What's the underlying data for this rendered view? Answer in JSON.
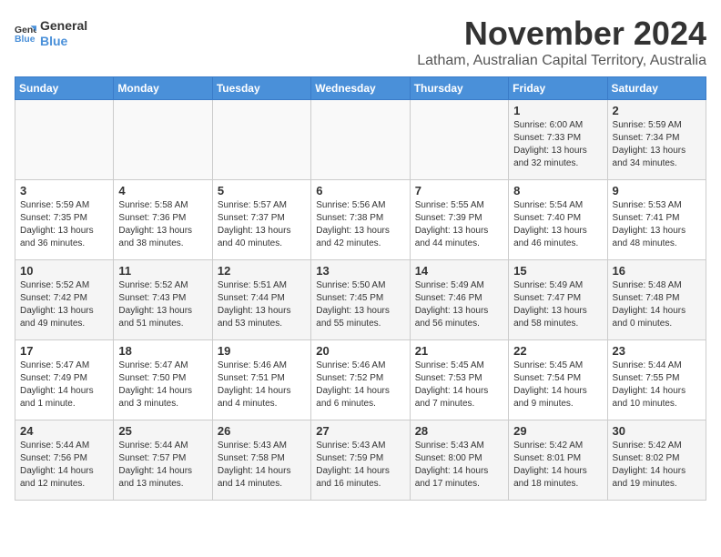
{
  "logo": {
    "line1": "General",
    "line2": "Blue"
  },
  "title": "November 2024",
  "location": "Latham, Australian Capital Territory, Australia",
  "days_of_week": [
    "Sunday",
    "Monday",
    "Tuesday",
    "Wednesday",
    "Thursday",
    "Friday",
    "Saturday"
  ],
  "weeks": [
    [
      {
        "day": "",
        "details": ""
      },
      {
        "day": "",
        "details": ""
      },
      {
        "day": "",
        "details": ""
      },
      {
        "day": "",
        "details": ""
      },
      {
        "day": "",
        "details": ""
      },
      {
        "day": "1",
        "details": "Sunrise: 6:00 AM\nSunset: 7:33 PM\nDaylight: 13 hours and 32 minutes."
      },
      {
        "day": "2",
        "details": "Sunrise: 5:59 AM\nSunset: 7:34 PM\nDaylight: 13 hours and 34 minutes."
      }
    ],
    [
      {
        "day": "3",
        "details": "Sunrise: 5:59 AM\nSunset: 7:35 PM\nDaylight: 13 hours and 36 minutes."
      },
      {
        "day": "4",
        "details": "Sunrise: 5:58 AM\nSunset: 7:36 PM\nDaylight: 13 hours and 38 minutes."
      },
      {
        "day": "5",
        "details": "Sunrise: 5:57 AM\nSunset: 7:37 PM\nDaylight: 13 hours and 40 minutes."
      },
      {
        "day": "6",
        "details": "Sunrise: 5:56 AM\nSunset: 7:38 PM\nDaylight: 13 hours and 42 minutes."
      },
      {
        "day": "7",
        "details": "Sunrise: 5:55 AM\nSunset: 7:39 PM\nDaylight: 13 hours and 44 minutes."
      },
      {
        "day": "8",
        "details": "Sunrise: 5:54 AM\nSunset: 7:40 PM\nDaylight: 13 hours and 46 minutes."
      },
      {
        "day": "9",
        "details": "Sunrise: 5:53 AM\nSunset: 7:41 PM\nDaylight: 13 hours and 48 minutes."
      }
    ],
    [
      {
        "day": "10",
        "details": "Sunrise: 5:52 AM\nSunset: 7:42 PM\nDaylight: 13 hours and 49 minutes."
      },
      {
        "day": "11",
        "details": "Sunrise: 5:52 AM\nSunset: 7:43 PM\nDaylight: 13 hours and 51 minutes."
      },
      {
        "day": "12",
        "details": "Sunrise: 5:51 AM\nSunset: 7:44 PM\nDaylight: 13 hours and 53 minutes."
      },
      {
        "day": "13",
        "details": "Sunrise: 5:50 AM\nSunset: 7:45 PM\nDaylight: 13 hours and 55 minutes."
      },
      {
        "day": "14",
        "details": "Sunrise: 5:49 AM\nSunset: 7:46 PM\nDaylight: 13 hours and 56 minutes."
      },
      {
        "day": "15",
        "details": "Sunrise: 5:49 AM\nSunset: 7:47 PM\nDaylight: 13 hours and 58 minutes."
      },
      {
        "day": "16",
        "details": "Sunrise: 5:48 AM\nSunset: 7:48 PM\nDaylight: 14 hours and 0 minutes."
      }
    ],
    [
      {
        "day": "17",
        "details": "Sunrise: 5:47 AM\nSunset: 7:49 PM\nDaylight: 14 hours and 1 minute."
      },
      {
        "day": "18",
        "details": "Sunrise: 5:47 AM\nSunset: 7:50 PM\nDaylight: 14 hours and 3 minutes."
      },
      {
        "day": "19",
        "details": "Sunrise: 5:46 AM\nSunset: 7:51 PM\nDaylight: 14 hours and 4 minutes."
      },
      {
        "day": "20",
        "details": "Sunrise: 5:46 AM\nSunset: 7:52 PM\nDaylight: 14 hours and 6 minutes."
      },
      {
        "day": "21",
        "details": "Sunrise: 5:45 AM\nSunset: 7:53 PM\nDaylight: 14 hours and 7 minutes."
      },
      {
        "day": "22",
        "details": "Sunrise: 5:45 AM\nSunset: 7:54 PM\nDaylight: 14 hours and 9 minutes."
      },
      {
        "day": "23",
        "details": "Sunrise: 5:44 AM\nSunset: 7:55 PM\nDaylight: 14 hours and 10 minutes."
      }
    ],
    [
      {
        "day": "24",
        "details": "Sunrise: 5:44 AM\nSunset: 7:56 PM\nDaylight: 14 hours and 12 minutes."
      },
      {
        "day": "25",
        "details": "Sunrise: 5:44 AM\nSunset: 7:57 PM\nDaylight: 14 hours and 13 minutes."
      },
      {
        "day": "26",
        "details": "Sunrise: 5:43 AM\nSunset: 7:58 PM\nDaylight: 14 hours and 14 minutes."
      },
      {
        "day": "27",
        "details": "Sunrise: 5:43 AM\nSunset: 7:59 PM\nDaylight: 14 hours and 16 minutes."
      },
      {
        "day": "28",
        "details": "Sunrise: 5:43 AM\nSunset: 8:00 PM\nDaylight: 14 hours and 17 minutes."
      },
      {
        "day": "29",
        "details": "Sunrise: 5:42 AM\nSunset: 8:01 PM\nDaylight: 14 hours and 18 minutes."
      },
      {
        "day": "30",
        "details": "Sunrise: 5:42 AM\nSunset: 8:02 PM\nDaylight: 14 hours and 19 minutes."
      }
    ]
  ]
}
